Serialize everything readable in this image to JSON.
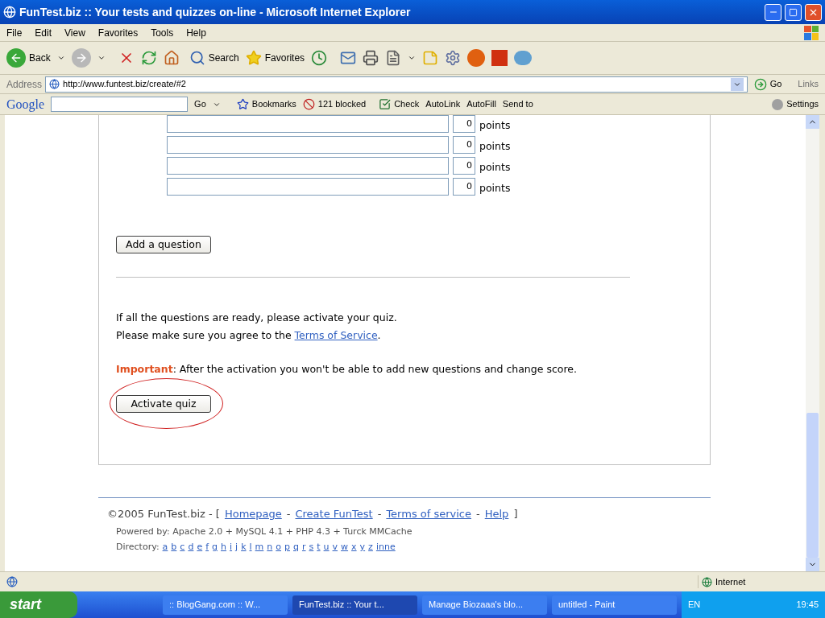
{
  "window": {
    "title": "FunTest.biz :: Your tests and quizzes on-line - Microsoft Internet Explorer"
  },
  "menu": [
    "File",
    "Edit",
    "View",
    "Favorites",
    "Tools",
    "Help"
  ],
  "toolbar": {
    "back": "Back",
    "search": "Search",
    "favorites": "Favorites"
  },
  "address": {
    "label": "Address",
    "url": "http://www.funtest.biz/create/#2",
    "go": "Go",
    "links": "Links"
  },
  "google_bar": {
    "logo": "Google",
    "go": "Go",
    "bookmarks": "Bookmarks",
    "blocked": "121 blocked",
    "check": "Check",
    "autolink": "AutoLink",
    "autofill": "AutoFill",
    "send_to": "Send to",
    "settings": "Settings"
  },
  "answers": [
    {
      "points": "0",
      "label": "points"
    },
    {
      "points": "0",
      "label": "points"
    },
    {
      "points": "0",
      "label": "points"
    },
    {
      "points": "0",
      "label": "points"
    }
  ],
  "add_button": "Add a question",
  "instructions": {
    "line_1": "If all the questions are ready, please activate your quiz.",
    "line_2": "Please make sure you agree to the",
    "link": "Terms of Service",
    "end": "."
  },
  "important": {
    "label": "Important",
    "text": ": After the activation you won't be able to add new questions and change score."
  },
  "activate_button": {
    "label": "Activate quiz",
    "circled": true
  },
  "footer": {
    "items": [
      {
        "kind": "text",
        "text": "©2005 FunTest.biz - ["
      },
      {
        "kind": "link",
        "text": "Homepage"
      },
      {
        "kind": "text",
        "text": "-"
      },
      {
        "kind": "link",
        "text": "Create FunTest"
      },
      {
        "kind": "text",
        "text": "-"
      },
      {
        "kind": "link",
        "text": "Terms of service"
      },
      {
        "kind": "text",
        "text": "-"
      },
      {
        "kind": "link",
        "text": "Help"
      },
      {
        "kind": "text",
        "text": "]"
      }
    ],
    "powered": "Powered by: Apache 2.0 + MySQL 4.1 + PHP 4.3 + Turck MMCache",
    "directory_label": "Directory:",
    "directory": [
      "a",
      "b",
      "c",
      "d",
      "e",
      "f",
      "g",
      "h",
      "i",
      "j",
      "k",
      "l",
      "m",
      "n",
      "o",
      "p",
      "q",
      "r",
      "s",
      "t",
      "u",
      "v",
      "w",
      "x",
      "y",
      "z",
      "inne"
    ]
  },
  "status_bar": {
    "zone": "Internet"
  },
  "taskbar": {
    "start": "start",
    "tasks": [
      {
        "label": ":: BlogGang.com :: W...",
        "selected": false
      },
      {
        "label": "FunTest.biz :: Your t...",
        "selected": true
      },
      {
        "label": "Manage Biozaaa's blo...",
        "selected": false
      },
      {
        "label": "untitled - Paint",
        "selected": false
      }
    ],
    "language": "EN",
    "clock": "19:45"
  }
}
